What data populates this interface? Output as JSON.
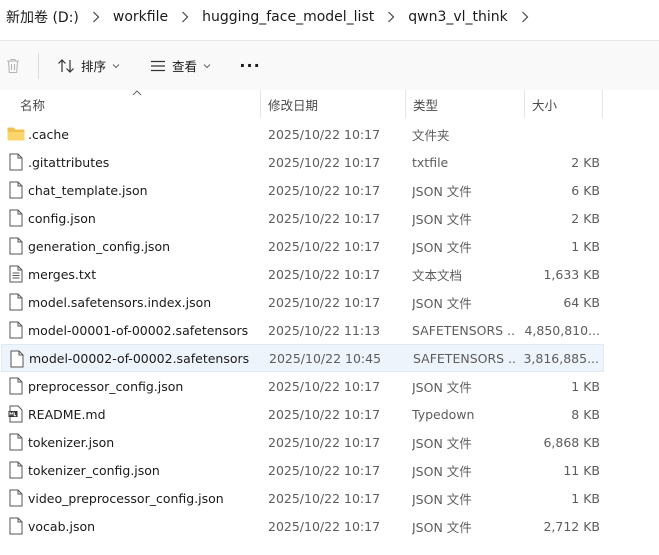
{
  "breadcrumb": [
    "新加卷 (D:)",
    "workfile",
    "hugging_face_model_list",
    "qwn3_vl_think"
  ],
  "toolbar": {
    "sort_label": "排序",
    "view_label": "查看",
    "more_label": "···"
  },
  "columns": {
    "name": "名称",
    "date": "修改日期",
    "type": "类型",
    "size": "大小"
  },
  "files": [
    {
      "name": ".cache",
      "date": "2025/10/22 10:17",
      "type": "文件夹",
      "size": "",
      "icon": "folder-icon"
    },
    {
      "name": ".gitattributes",
      "date": "2025/10/22 10:17",
      "type": "txtfile",
      "size": "2 KB",
      "icon": "file-icon"
    },
    {
      "name": "chat_template.json",
      "date": "2025/10/22 10:17",
      "type": "JSON 文件",
      "size": "6 KB",
      "icon": "file-icon"
    },
    {
      "name": "config.json",
      "date": "2025/10/22 10:17",
      "type": "JSON 文件",
      "size": "2 KB",
      "icon": "file-icon"
    },
    {
      "name": "generation_config.json",
      "date": "2025/10/22 10:17",
      "type": "JSON 文件",
      "size": "1 KB",
      "icon": "file-icon"
    },
    {
      "name": "merges.txt",
      "date": "2025/10/22 10:17",
      "type": "文本文档",
      "size": "1,633 KB",
      "icon": "text-file-icon"
    },
    {
      "name": "model.safetensors.index.json",
      "date": "2025/10/22 10:17",
      "type": "JSON 文件",
      "size": "64 KB",
      "icon": "file-icon"
    },
    {
      "name": "model-00001-of-00002.safetensors",
      "date": "2025/10/22 11:13",
      "type": "SAFETENSORS ...",
      "size": "4,850,810...",
      "icon": "file-icon"
    },
    {
      "name": "model-00002-of-00002.safetensors",
      "date": "2025/10/22 10:45",
      "type": "SAFETENSORS ...",
      "size": "3,816,885...",
      "icon": "file-icon",
      "selected": true
    },
    {
      "name": "preprocessor_config.json",
      "date": "2025/10/22 10:17",
      "type": "JSON 文件",
      "size": "1 KB",
      "icon": "file-icon"
    },
    {
      "name": "README.md",
      "date": "2025/10/22 10:17",
      "type": "Typedown",
      "size": "8 KB",
      "icon": "markdown-file-icon"
    },
    {
      "name": "tokenizer.json",
      "date": "2025/10/22 10:17",
      "type": "JSON 文件",
      "size": "6,868 KB",
      "icon": "file-icon"
    },
    {
      "name": "tokenizer_config.json",
      "date": "2025/10/22 10:17",
      "type": "JSON 文件",
      "size": "11 KB",
      "icon": "file-icon"
    },
    {
      "name": "video_preprocessor_config.json",
      "date": "2025/10/22 10:17",
      "type": "JSON 文件",
      "size": "1 KB",
      "icon": "file-icon"
    },
    {
      "name": "vocab.json",
      "date": "2025/10/22 10:17",
      "type": "JSON 文件",
      "size": "2,712 KB",
      "icon": "file-icon"
    }
  ]
}
